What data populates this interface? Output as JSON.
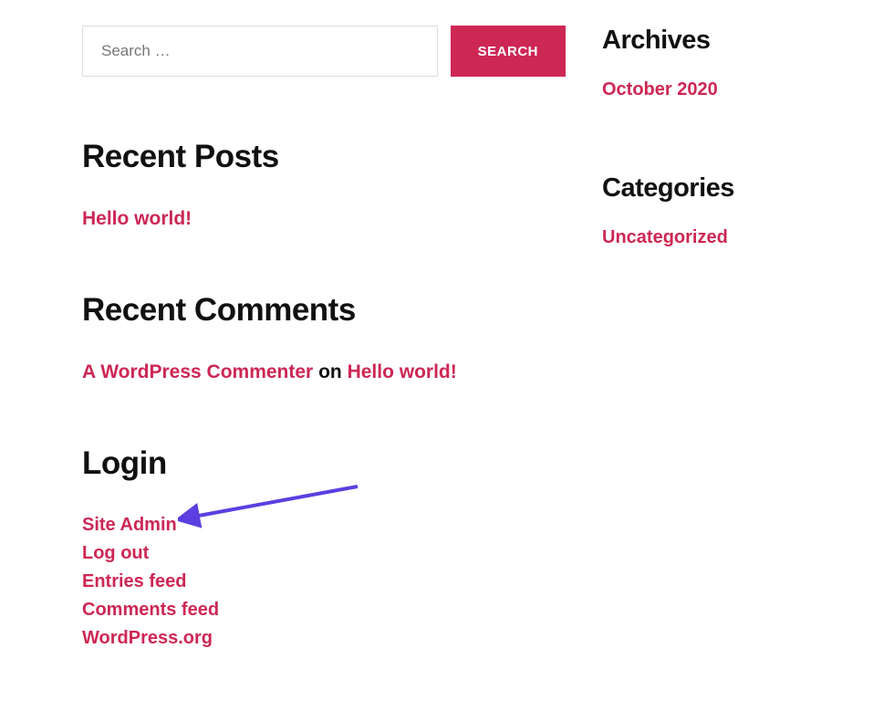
{
  "search": {
    "placeholder": "Search …",
    "button": "SEARCH"
  },
  "recentPosts": {
    "title": "Recent Posts",
    "items": [
      "Hello world!"
    ]
  },
  "recentComments": {
    "title": "Recent Comments",
    "items": [
      {
        "author": "A WordPress Commenter",
        "on": "on",
        "post": "Hello world!"
      }
    ]
  },
  "login": {
    "title": "Login",
    "items": [
      "Site Admin",
      "Log out",
      "Entries feed",
      "Comments feed",
      "WordPress.org"
    ]
  },
  "archives": {
    "title": "Archives",
    "items": [
      "October 2020"
    ]
  },
  "categories": {
    "title": "Categories",
    "items": [
      "Uncategorized"
    ]
  }
}
